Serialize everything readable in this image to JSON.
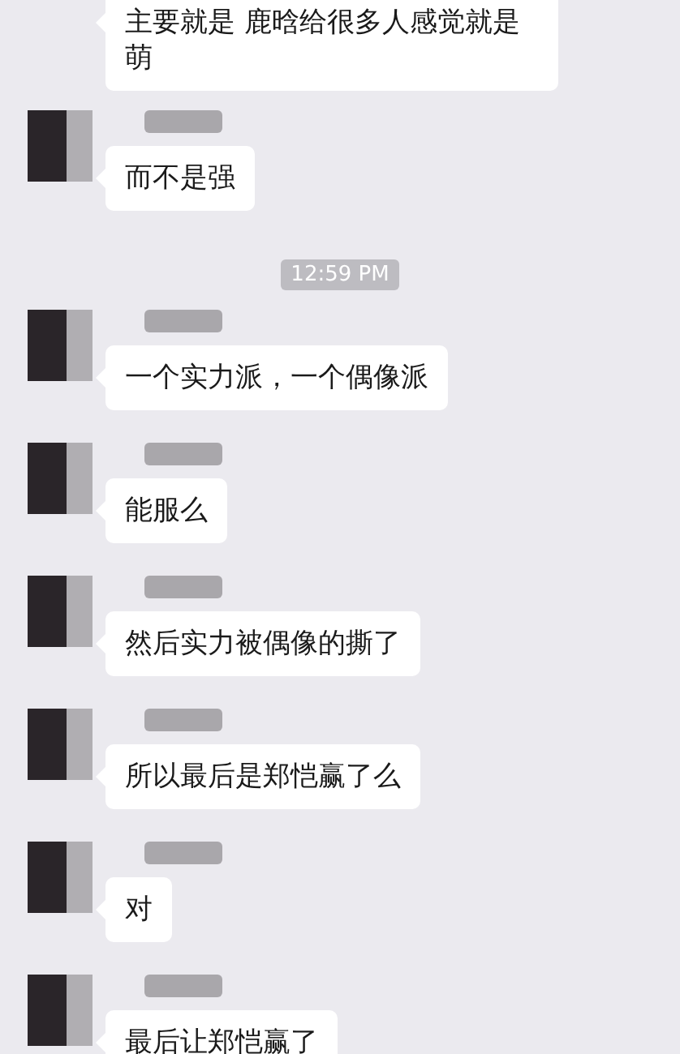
{
  "messages": [
    {
      "kind": "text",
      "show_sender": false,
      "text": "主要就是 鹿晗给很多人感觉就是萌"
    },
    {
      "kind": "text",
      "show_sender": true,
      "text": "而不是强"
    },
    {
      "kind": "time",
      "text": "12:59 PM"
    },
    {
      "kind": "text",
      "show_sender": true,
      "text": "一个实力派，一个偶像派"
    },
    {
      "kind": "text",
      "show_sender": true,
      "text": "能服么"
    },
    {
      "kind": "text",
      "show_sender": true,
      "text": "然后实力被偶像的撕了"
    },
    {
      "kind": "text",
      "show_sender": true,
      "text": "所以最后是郑恺赢了么"
    },
    {
      "kind": "text",
      "show_sender": true,
      "text": "对"
    },
    {
      "kind": "text",
      "show_sender": true,
      "text": "最后让郑恺赢了"
    }
  ]
}
